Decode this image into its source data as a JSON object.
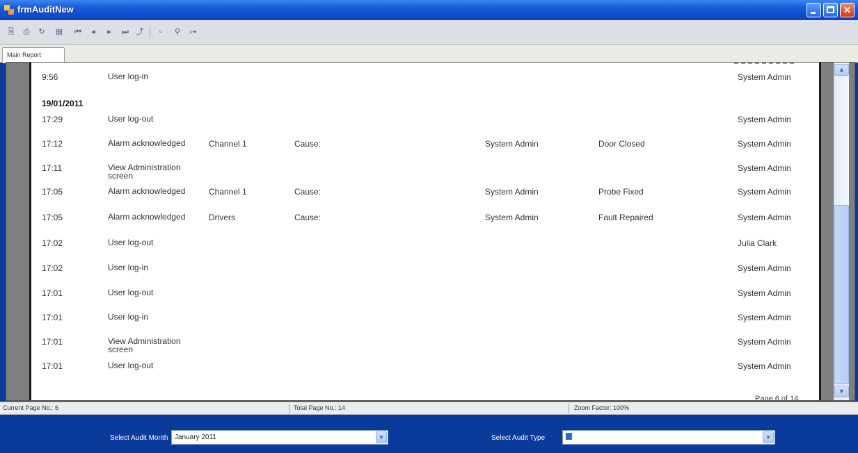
{
  "window": {
    "title": "frmAuditNew"
  },
  "tabs": [
    {
      "label": "Main Report"
    }
  ],
  "report": {
    "rows": [
      {
        "type": "row",
        "time": "9:56",
        "event": "User log-in",
        "channel": "",
        "cause": "",
        "ackby": "",
        "action": "",
        "user": "System Admin"
      },
      {
        "type": "date",
        "date": "19/01/2011"
      },
      {
        "type": "row",
        "time": "17:29",
        "event": "User log-out",
        "channel": "",
        "cause": "",
        "ackby": "",
        "action": "",
        "user": "System Admin"
      },
      {
        "type": "row",
        "time": "17:12",
        "event": "Alarm acknowledged",
        "channel": "Channel 1",
        "cause": "Cause:",
        "ackby": "System Admin",
        "action": "Door Closed",
        "user": "System Admin"
      },
      {
        "type": "row",
        "time": "17:11",
        "event": "View Administration screen",
        "channel": "",
        "cause": "",
        "ackby": "",
        "action": "",
        "user": "System Admin"
      },
      {
        "type": "row",
        "time": "17:05",
        "event": "Alarm acknowledged",
        "channel": "Channel 1",
        "cause": "Cause:",
        "ackby": "System Admin",
        "action": "Probe Fixed",
        "user": "System Admin"
      },
      {
        "type": "row",
        "time": "17:05",
        "event": "Alarm acknowledged",
        "channel": "Drivers",
        "cause": "Cause:",
        "ackby": "System Admin",
        "action": "Fault Repaired",
        "user": "System Admin"
      },
      {
        "type": "row",
        "time": "17:02",
        "event": "User log-out",
        "channel": "",
        "cause": "",
        "ackby": "",
        "action": "",
        "user": "Julia Clark"
      },
      {
        "type": "row",
        "time": "17:02",
        "event": "User log-in",
        "channel": "",
        "cause": "",
        "ackby": "",
        "action": "",
        "user": "System Admin"
      },
      {
        "type": "row",
        "time": "17:01",
        "event": "User log-out",
        "channel": "",
        "cause": "",
        "ackby": "",
        "action": "",
        "user": "System Admin"
      },
      {
        "type": "row",
        "time": "17:01",
        "event": "User log-in",
        "channel": "",
        "cause": "",
        "ackby": "",
        "action": "",
        "user": "System Admin"
      },
      {
        "type": "row",
        "time": "17:01",
        "event": "View Administration screen",
        "channel": "",
        "cause": "",
        "ackby": "",
        "action": "",
        "user": "System Admin"
      },
      {
        "type": "row",
        "time": "17:01",
        "event": "User log-out",
        "channel": "",
        "cause": "",
        "ackby": "",
        "action": "",
        "user": "System Admin"
      }
    ],
    "page_footer": "Page 6 of 14"
  },
  "status": {
    "current_page": "Current Page No.: 6",
    "total_pages": "Total Page No.: 14",
    "zoom": "Zoom Factor: 100%"
  },
  "filters": {
    "month_label": "Select Audit Month",
    "month_value": "January 2011",
    "type_label": "Select Audit Type",
    "type_value": ""
  },
  "icons": {
    "toolbar": [
      "export-icon",
      "print-icon",
      "refresh-icon",
      "group-tree-icon",
      "first-page-icon",
      "previous-page-icon",
      "next-page-icon",
      "last-page-icon",
      "goto-page-icon",
      "stop-icon",
      "search-icon",
      "zoom-icon"
    ]
  }
}
